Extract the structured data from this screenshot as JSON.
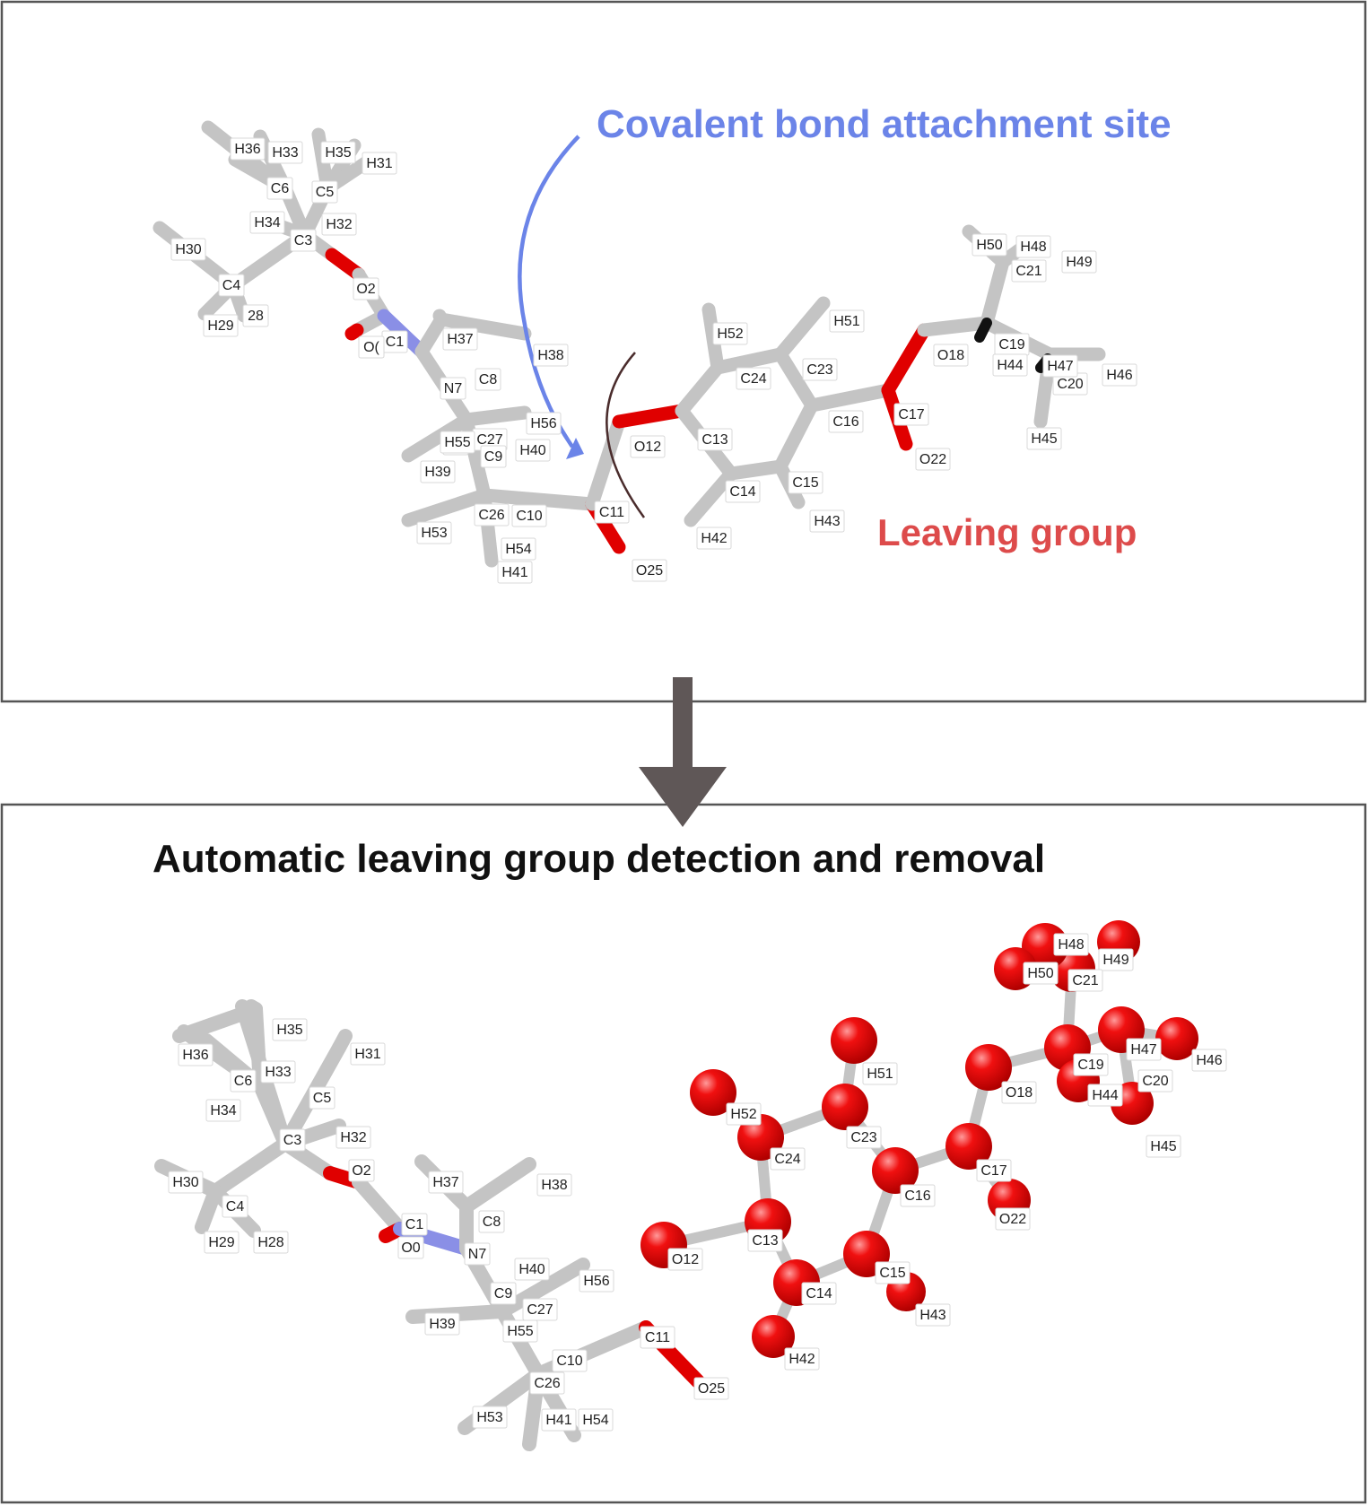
{
  "annotations": {
    "attachment": "Covalent bond attachment site",
    "leaving": "Leaving group",
    "title": "Automatic leaving group detection and removal"
  },
  "colors": {
    "attachment": "#6b84e8",
    "leaving": "#dd4b4b",
    "bond": "#c4c4c4",
    "oxygen": "#e00000",
    "nitrogen": "#8a8fe6",
    "frame": "#555555",
    "arrow": "#5f5757"
  },
  "panel1": {
    "labels": [
      "H36",
      "H33",
      "H35",
      "H31",
      "C6",
      "C5",
      "H34",
      "H32",
      "C3",
      "H30",
      "C4",
      "O2",
      "H29",
      "28",
      "C1",
      "O(",
      "H37",
      "H38",
      "N7",
      "C8",
      "H5",
      "C27",
      "H56",
      "H55",
      "C9",
      "H40",
      "H39",
      "C26",
      "C10",
      "C11",
      "H53",
      "H54",
      "H41",
      "O25",
      "O12",
      "C13",
      "C14",
      "H42",
      "C15",
      "H43",
      "C24",
      "H52",
      "C23",
      "H51",
      "C16",
      "C17",
      "O22",
      "O18",
      "C19",
      "H44",
      "C20",
      "H47",
      "H46",
      "H45",
      "C21",
      "H50",
      "H48",
      "H49"
    ]
  },
  "panel2": {
    "labels": [
      "H35",
      "H36",
      "C6",
      "H33",
      "H31",
      "H34",
      "C5",
      "H32",
      "C3",
      "O2",
      "H30",
      "C4",
      "H29",
      "H28",
      "H37",
      "H38",
      "C1",
      "C8",
      "O0",
      "N7",
      "H40",
      "H56",
      "C9",
      "C27",
      "H39",
      "H55",
      "C11",
      "C10",
      "C26",
      "O25",
      "H53",
      "H41",
      "H54",
      "O12",
      "C13",
      "C14",
      "H42",
      "C15",
      "H43",
      "C24",
      "H52",
      "C23",
      "H51",
      "C16",
      "C17",
      "O22",
      "O18",
      "C19",
      "H44",
      "H47",
      "H46",
      "C20",
      "H45",
      "H48",
      "H49",
      "H50",
      "C21"
    ]
  }
}
